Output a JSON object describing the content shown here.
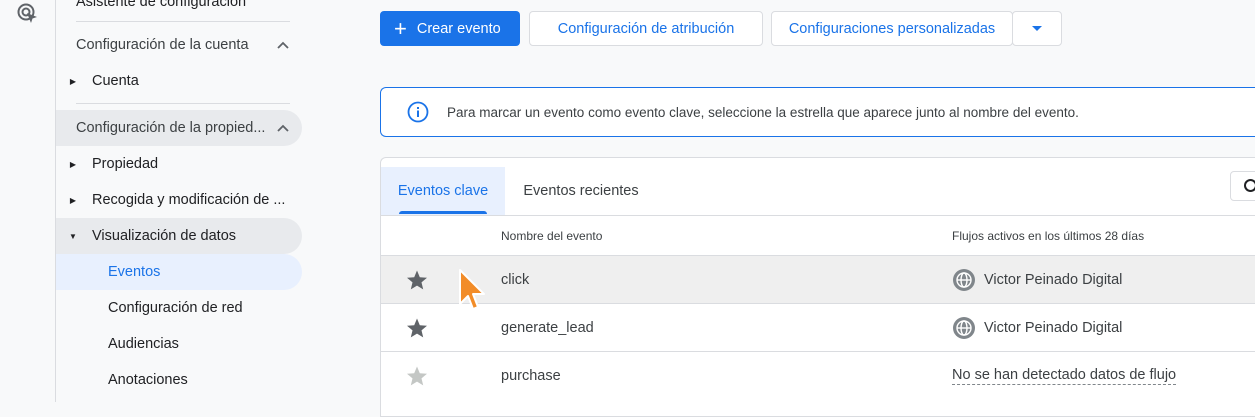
{
  "sidebar": {
    "top_cut_label": "Asistente de configuración",
    "account_section": "Configuración de la cuenta",
    "account_item": "Cuenta",
    "property_section": "Configuración de la propied...",
    "property_items": [
      "Propiedad",
      "Recogida y modificación de ...",
      "Visualización de datos"
    ],
    "data_display_children": [
      "Eventos",
      "Configuración de red",
      "Audiencias",
      "Anotaciones"
    ]
  },
  "toolbar": {
    "create_event": "Crear evento",
    "attribution_settings": "Configuración de atribución",
    "custom_settings": "Configuraciones personalizadas"
  },
  "banner": {
    "text": "Para marcar un evento como evento clave, seleccione la estrella que aparece junto al nombre del evento."
  },
  "tabs": [
    "Eventos clave",
    "Eventos recientes"
  ],
  "table": {
    "headers": [
      "Nombre del evento",
      "Flujos activos en los últimos 28 días"
    ],
    "rows": [
      {
        "name": "click",
        "flow": "Victor Peinado Digital"
      },
      {
        "name": "generate_lead",
        "flow": "Victor Peinado Digital"
      },
      {
        "name": "purchase",
        "flow": "No se han detectado datos de flujo"
      }
    ]
  },
  "colors": {
    "accent": "#1a73e8",
    "selected_bg": "#e8f0fe",
    "section_bg": "#e8eaed",
    "star_active": "#5f6368",
    "star_inactive": "#c4c7c5",
    "cursor": "#f28c28"
  }
}
